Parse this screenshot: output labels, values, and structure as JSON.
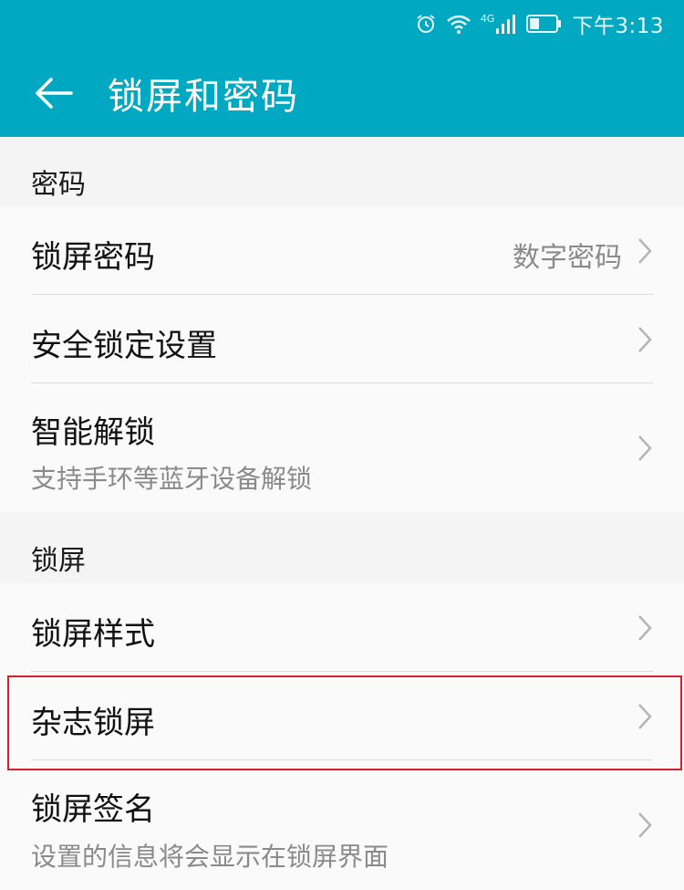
{
  "status_bar": {
    "time": "下午3:13",
    "network": "4G",
    "icons": [
      "alarm-icon",
      "wifi-icon",
      "signal-icon",
      "battery-icon"
    ]
  },
  "toolbar": {
    "title": "锁屏和密码",
    "back_icon": "back-arrow-icon"
  },
  "sections": [
    {
      "header": "密码",
      "items": [
        {
          "title": "锁屏密码",
          "value": "数字密码"
        },
        {
          "title": "安全锁定设置"
        },
        {
          "title": "智能解锁",
          "subtitle": "支持手环等蓝牙设备解锁"
        }
      ]
    },
    {
      "header": "锁屏",
      "items": [
        {
          "title": "锁屏样式"
        },
        {
          "title": "杂志锁屏"
        },
        {
          "title": "锁屏签名",
          "subtitle": "设置的信息将会显示在锁屏界面"
        }
      ]
    }
  ],
  "colors": {
    "accent": "#00a8c1",
    "highlight": "#d8202f"
  }
}
